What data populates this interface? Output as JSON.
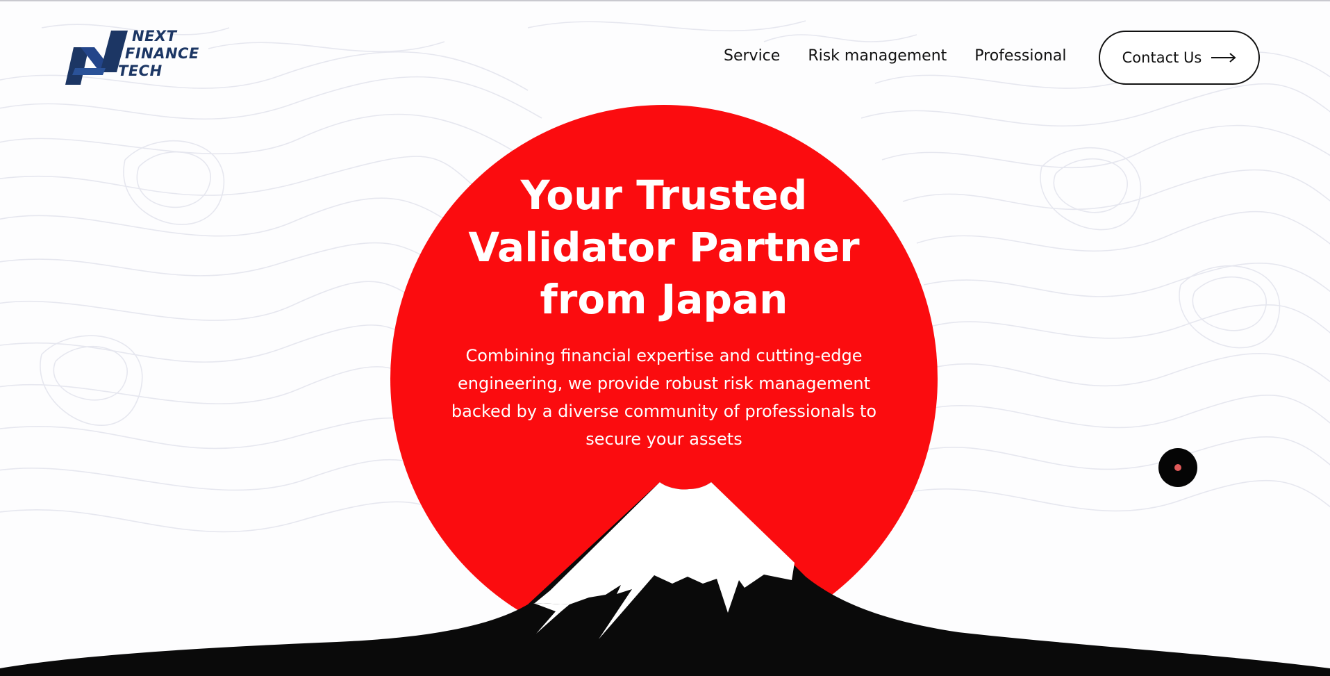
{
  "brand": {
    "logo_lines": [
      "NEXT",
      "FINANCE",
      "TECH"
    ],
    "color": "#1c3664"
  },
  "nav": {
    "items": [
      "Service",
      "Risk management",
      "Professional"
    ],
    "contact_label": "Contact Us",
    "contact_icon": "arrow-right-icon"
  },
  "hero": {
    "title_lines": [
      "Your Trusted",
      "Validator Partner",
      "from Japan"
    ],
    "subtitle_lines": [
      "Combining financial expertise and cutting-edge",
      "engineering, we provide robust risk management",
      "backed by a diverse community of professionals to",
      "secure your assets"
    ],
    "sun_color": "#fb0c0f",
    "mountain_color": "#0a0a0a",
    "snow_color": "#ffffff"
  },
  "widget": {
    "icon": "record-dot-icon",
    "dot_color": "#e05a5a"
  }
}
